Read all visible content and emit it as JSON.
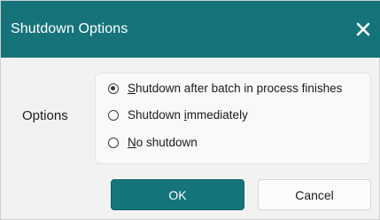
{
  "dialog": {
    "title": "Shutdown Options",
    "close_icon": "close-icon",
    "colors": {
      "titlebar": "#16737a",
      "ok_button": "#15757b"
    }
  },
  "options": {
    "label": "Options",
    "items": [
      {
        "pre": "",
        "accel": "S",
        "post": "hutdown after batch in process finishes",
        "checked": true
      },
      {
        "pre": "Shutdown ",
        "accel": "i",
        "post": "mmediately",
        "checked": false
      },
      {
        "pre": "",
        "accel": "N",
        "post": "o shutdown",
        "checked": false
      }
    ]
  },
  "buttons": {
    "ok_label": "OK",
    "cancel_label": "Cancel"
  }
}
